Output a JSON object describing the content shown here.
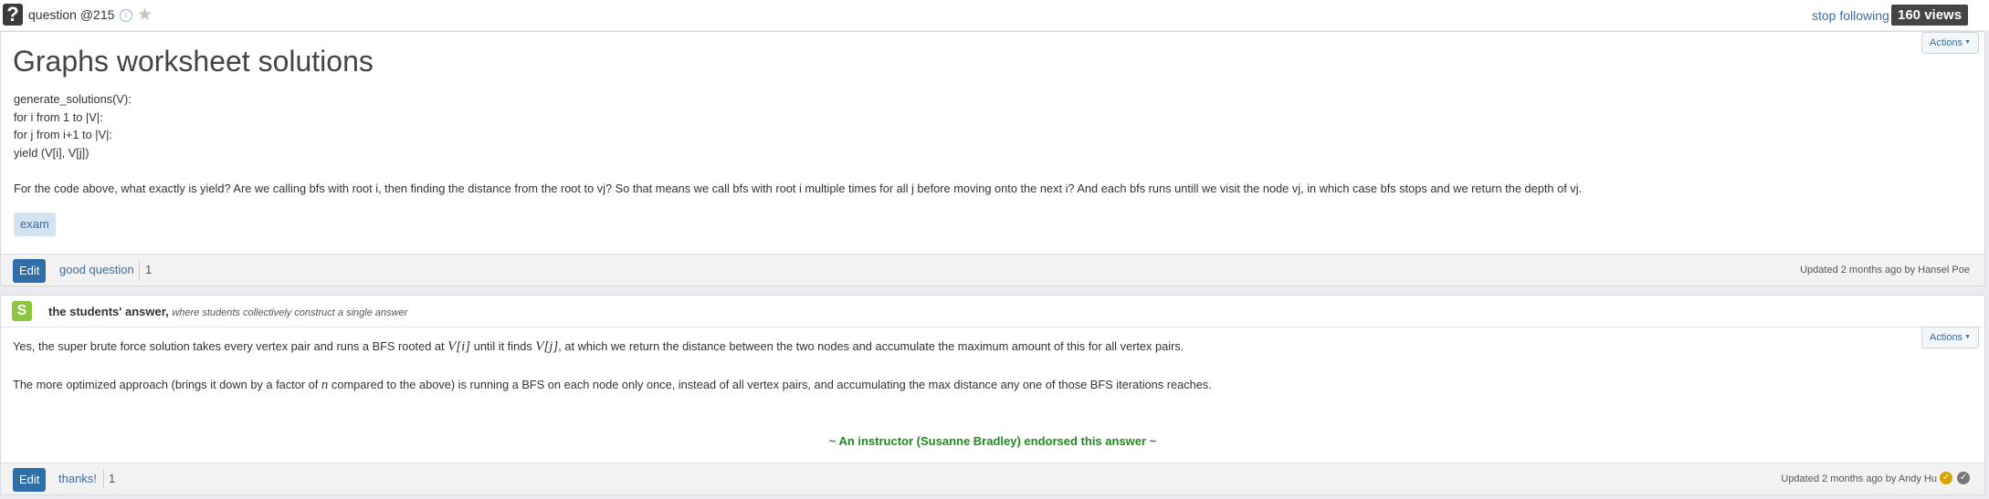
{
  "topbar": {
    "question_label": "question",
    "question_number": "@215",
    "stop_following": "stop following",
    "views": "160 views"
  },
  "question": {
    "actions_label": "Actions",
    "title": "Graphs worksheet solutions",
    "code_lines": [
      "generate_solutions(V):",
      "for i from 1 to |V|:",
      "for j from i+1 to |V|:",
      "yield (V[i], V[j])"
    ],
    "paragraph": "For the code above, what exactly is yield? Are we calling bfs with root i, then finding the distance from the root to vj? So that means we call bfs with root i multiple times for all j before moving onto the next i? And each bfs runs untill we visit the node vj, in which case bfs stops and we return the depth of vj.",
    "tag": "exam",
    "edit_label": "Edit",
    "good_question_label": "good question",
    "good_question_count": "1",
    "updated": "Updated 2 months ago by Hansel Poe"
  },
  "answer": {
    "badge": "S",
    "header_bold": "the students' answer,",
    "header_italic": "where students collectively construct a single answer",
    "actions_label": "Actions",
    "p1_a": "Yes, the super brute force solution takes every vertex pair and runs a BFS rooted at ",
    "p1_math1": "V[i]",
    "p1_b": " until it finds ",
    "p1_math2": "V[j]",
    "p1_c": ", at which we return the distance between the two nodes and accumulate the maximum amount of this for all vertex pairs.",
    "p2_a": "The more optimized approach (brings it down by a factor of ",
    "p2_math": "n",
    "p2_b": " compared to the above) is running a BFS on each node only once, instead of all vertex pairs, and accumulating the max distance any one of those BFS iterations reaches.",
    "endorsement": "~ An instructor (Susanne Bradley) endorsed this answer ~",
    "edit_label": "Edit",
    "thanks_label": "thanks!",
    "thanks_count": "1",
    "updated": "Updated 2 months ago by Andy Hu"
  },
  "colors": {
    "accent": "#2f6ea8",
    "link": "#3b6da3",
    "endorse": "#1f8a1f",
    "student_badge": "#8cc63f"
  },
  "icons": [
    "question-icon",
    "info-icon",
    "star-icon",
    "caret-down-icon",
    "gold-check-icon",
    "check-icon"
  ]
}
